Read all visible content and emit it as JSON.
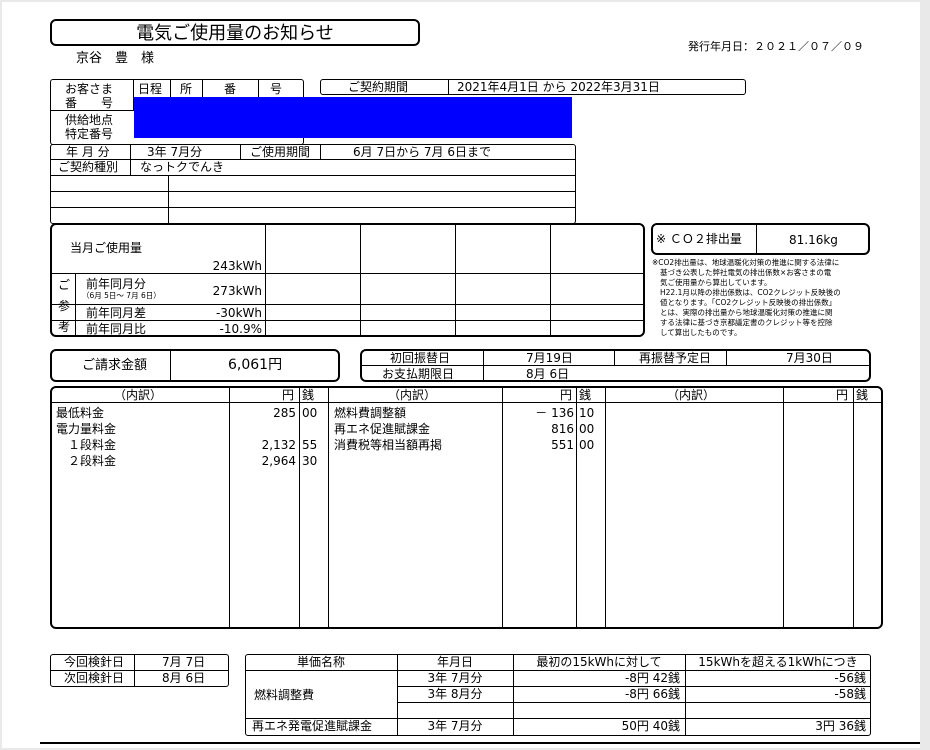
{
  "header": {
    "title": "電気ご使用量のお知らせ",
    "customer_name": "京谷　豊　様",
    "issue_date": "発行年月日：２０２１／０７／０９"
  },
  "contract": {
    "customer_no_label_1": "お客さま",
    "customer_no_label_2": "番　　号",
    "route_labels": [
      "日程",
      "所",
      "番",
      "号"
    ],
    "period_label": "ご契約期間",
    "period_value": "2021年4月1日 から 2022年3月31日",
    "supply_label_1": "供給地点",
    "supply_label_2": "特定番号",
    "month_label": "年 月 分",
    "month_value": "3年 7月分",
    "usage_period_label": "ご使用期間",
    "usage_period_value": "6月 7日から 7月 6日まで",
    "type_label": "ご契約種別",
    "type_value": "なっトクでんき"
  },
  "usage": {
    "current_label": "当月ご使用量",
    "current_value": "243kWh",
    "side_label": [
      "ご",
      "参",
      "考"
    ],
    "prev_label": "前年同月分",
    "prev_sub": "（6月 5日～ 7月 6日）",
    "prev_value": "273kWh",
    "diff_label": "前年同月差",
    "diff_value": "-30kWh",
    "ratio_label": "前年同月比",
    "ratio_value": "-10.9%"
  },
  "co2": {
    "label": "※ ＣＯ２排出量",
    "value": "81.16kg",
    "note": [
      "※CO2排出量は、地球温暖化対策の推進に関する法律に",
      "基づき公表した弊社電気の排出係数×お客さまの電",
      "気ご使用量から算出しています。",
      "H22.1月以降の排出係数は、CO2クレジット反映後の",
      "値となります。「CO2クレジット反映後の排出係数」",
      "とは、実際の排出量から地球温暖化対策の推進に関",
      "する法律に基づき京都議定書のクレジット等を控除",
      "して算出したものです。"
    ]
  },
  "billing": {
    "amount_label": "ご請求金額",
    "amount_value": "6,061円",
    "first_transfer_label": "初回振替日",
    "first_transfer_value": "7月19日",
    "retransfer_label": "再振替予定日",
    "retransfer_value": "7月30日",
    "due_label": "お支払期限日",
    "due_value": "8月 6日"
  },
  "breakdown": {
    "header_label": "（内訳）",
    "yen_label": "円",
    "sen_label": "銭",
    "col1": [
      {
        "label": "最低料金",
        "yen": "285",
        "sen": "00"
      },
      {
        "label": "電力量料金",
        "yen": "",
        "sen": ""
      },
      {
        "label": "　１段料金",
        "yen": "2,132",
        "sen": "55"
      },
      {
        "label": "　２段料金",
        "yen": "2,964",
        "sen": "30"
      }
    ],
    "col2": [
      {
        "label": "燃料費調整額",
        "yen": "－ 136",
        "sen": "10"
      },
      {
        "label": "再エネ促進賦課金",
        "yen": "816",
        "sen": "00"
      },
      {
        "label": "消費税等相当額再掲",
        "yen": "551",
        "sen": "00"
      }
    ]
  },
  "meter": {
    "this_label": "今回検針日",
    "this_value": "7月 7日",
    "next_label": "次回検針日",
    "next_value": "8月 6日"
  },
  "unit_price": {
    "headers": [
      "単価名称",
      "年月日",
      "最初の15kWhに対して",
      "15kWhを超える1kWhにつき"
    ],
    "fuel_label": "燃料調整費",
    "fuel_rows": [
      {
        "date": "3年 7月分",
        "first": "-8円 42銭",
        "over": "-56銭"
      },
      {
        "date": "3年 8月分",
        "first": "-8円 66銭",
        "over": "-58銭"
      }
    ],
    "renew_label": "再エネ発電促進賦課金",
    "renew_row": {
      "date": "3年 7月分",
      "first": "50円 40銭",
      "over": "3円 36銭"
    }
  }
}
